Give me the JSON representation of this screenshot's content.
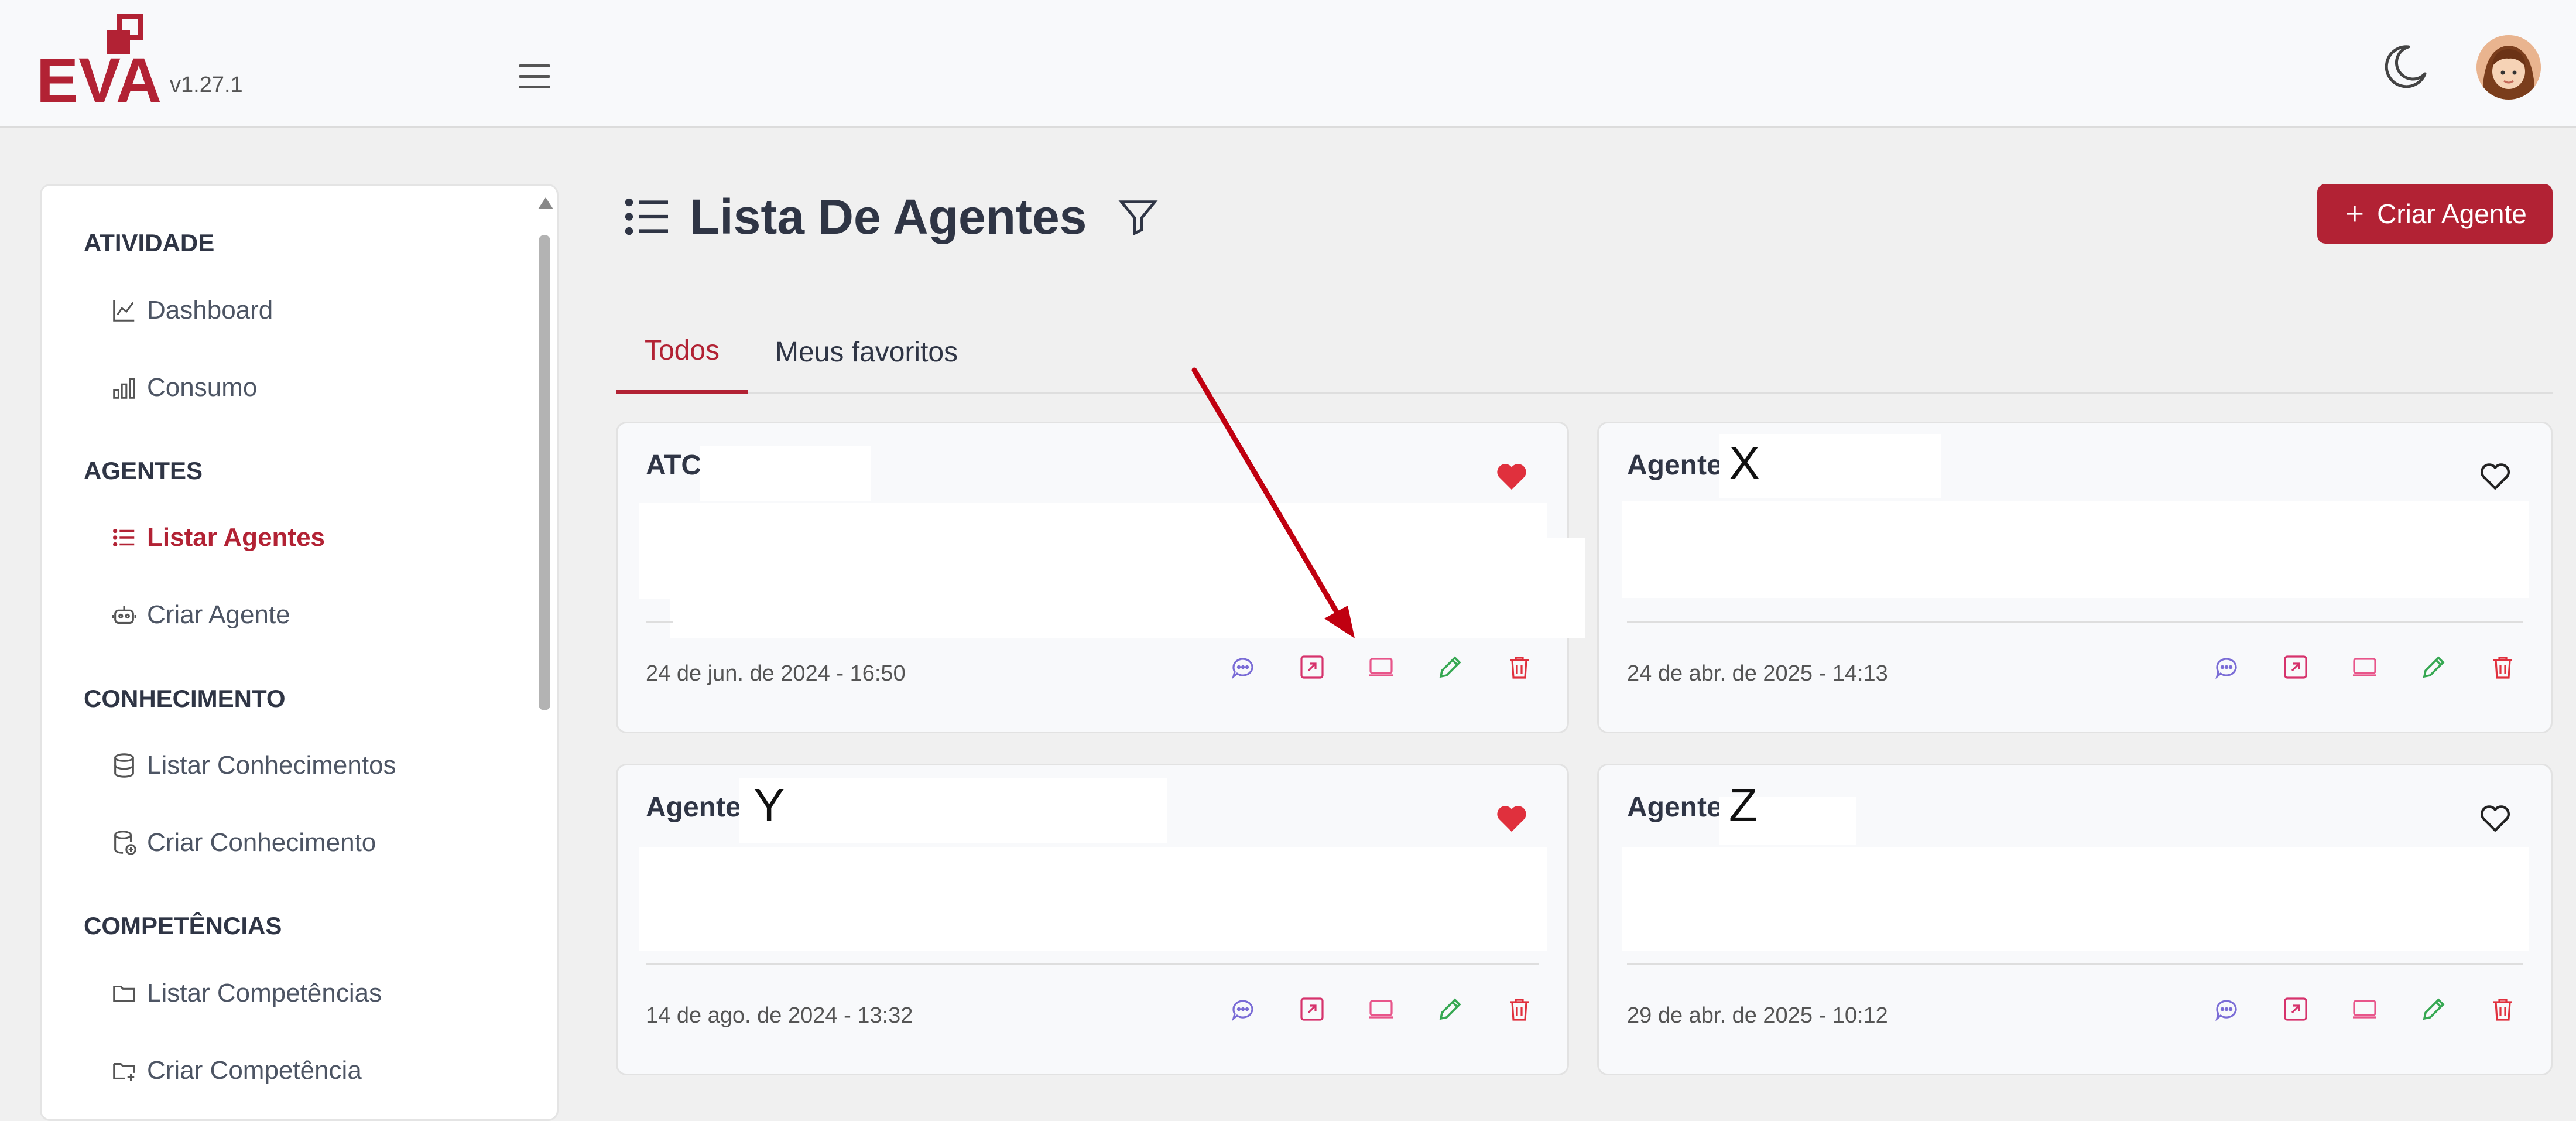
{
  "app": {
    "logo_text": "EVA",
    "version": "v1.27.1",
    "colors": {
      "brand": "#b22234",
      "background": "#f0f0f0"
    }
  },
  "sidebar": {
    "sections": [
      {
        "title": "ATIVIDADE",
        "items": [
          {
            "label": "Dashboard",
            "icon": "line-chart-icon"
          },
          {
            "label": "Consumo",
            "icon": "bar-chart-icon"
          }
        ]
      },
      {
        "title": "AGENTES",
        "items": [
          {
            "label": "Listar Agentes",
            "icon": "list-icon",
            "active": true
          },
          {
            "label": "Criar Agente",
            "icon": "robot-icon"
          }
        ]
      },
      {
        "title": "CONHECIMENTO",
        "items": [
          {
            "label": "Listar Conhecimentos",
            "icon": "database-icon"
          },
          {
            "label": "Criar Conhecimento",
            "icon": "database-add-icon"
          }
        ]
      },
      {
        "title": "COMPETÊNCIAS",
        "items": [
          {
            "label": "Listar Competências",
            "icon": "folder-icon"
          },
          {
            "label": "Criar Competência",
            "icon": "folder-add-icon"
          }
        ]
      }
    ]
  },
  "main": {
    "title": "Lista De Agentes",
    "create_button": "Criar Agente",
    "tabs": [
      {
        "label": "Todos",
        "active": true
      },
      {
        "label": "Meus favoritos",
        "active": false
      }
    ],
    "cards": [
      {
        "name": "ATC",
        "suffix": "",
        "date": "24 de jun. de 2024 - 16:50",
        "favorite": true
      },
      {
        "name": "Agente",
        "suffix": "X",
        "date": "24 de abr. de 2025 - 14:13",
        "favorite": false
      },
      {
        "name": "Agente",
        "suffix": "Y",
        "date": "14 de ago. de 2024 - 13:32",
        "favorite": true
      },
      {
        "name": "Agente",
        "suffix": "Z",
        "date": "29 de abr. de 2025 - 10:12",
        "favorite": false
      }
    ],
    "card_action_icons": [
      "chat-icon",
      "open-external-icon",
      "monitor-icon",
      "edit-pencil-icon",
      "trash-icon"
    ]
  }
}
